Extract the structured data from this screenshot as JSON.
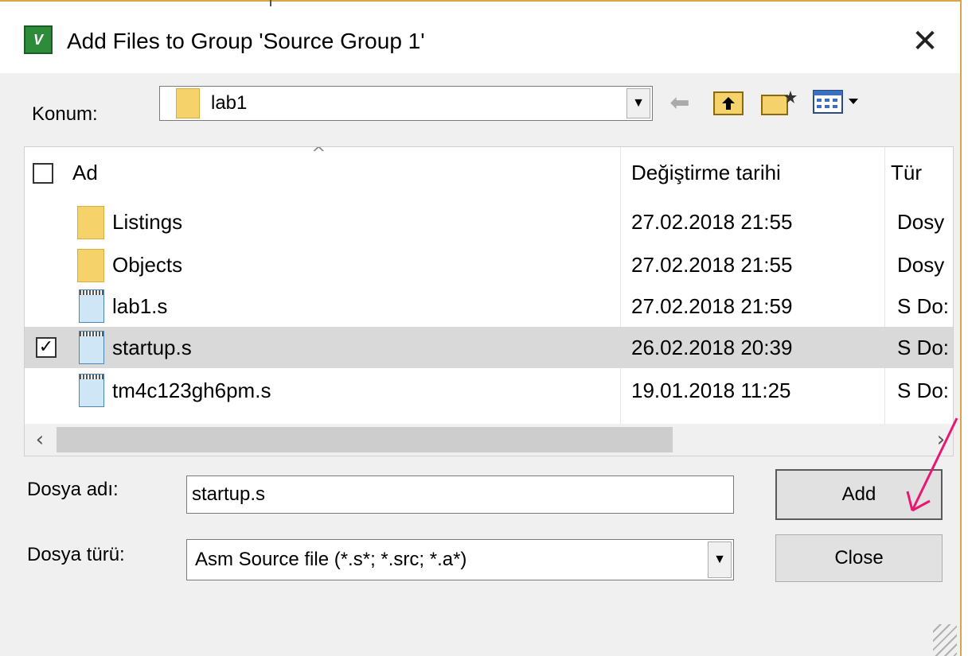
{
  "window": {
    "title": "Add Files to Group 'Source Group 1'",
    "app_icon": "uv-app-icon",
    "close_glyph": "✕"
  },
  "location": {
    "label": "Konum:",
    "value": "lab1"
  },
  "toolbar": {
    "back_icon": "back-arrow-icon",
    "up_icon": "up-folder-icon",
    "new_folder_icon": "new-folder-icon",
    "view_icon": "view-menu-icon"
  },
  "file_list": {
    "columns": [
      "Ad",
      "Değiştirme tarihi",
      "Tür"
    ],
    "rows": [
      {
        "name": "Listings",
        "date": "27.02.2018 21:55",
        "type": "Dosy",
        "kind": "folder",
        "checked": false,
        "selected": false
      },
      {
        "name": "Objects",
        "date": "27.02.2018 21:55",
        "type": "Dosy",
        "kind": "folder",
        "checked": false,
        "selected": false
      },
      {
        "name": "lab1.s",
        "date": "27.02.2018 21:59",
        "type": "S Do:",
        "kind": "file",
        "checked": false,
        "selected": false
      },
      {
        "name": "startup.s",
        "date": "26.02.2018 20:39",
        "type": "S Do:",
        "kind": "file",
        "checked": true,
        "selected": true
      },
      {
        "name": "tm4c123gh6pm.s",
        "date": "19.01.2018 11:25",
        "type": "S Do:",
        "kind": "file",
        "checked": false,
        "selected": false
      }
    ]
  },
  "filename": {
    "label": "Dosya adı:",
    "value": "startup.s"
  },
  "filetype": {
    "label": "Dosya türü:",
    "value": "Asm Source file (*.s*; *.src; *.a*)"
  },
  "buttons": {
    "add": "Add",
    "close": "Close"
  },
  "colors": {
    "annotation_arrow": "#e8176f",
    "selected_row": "#d9d9d9",
    "folder": "#f6d26b"
  }
}
